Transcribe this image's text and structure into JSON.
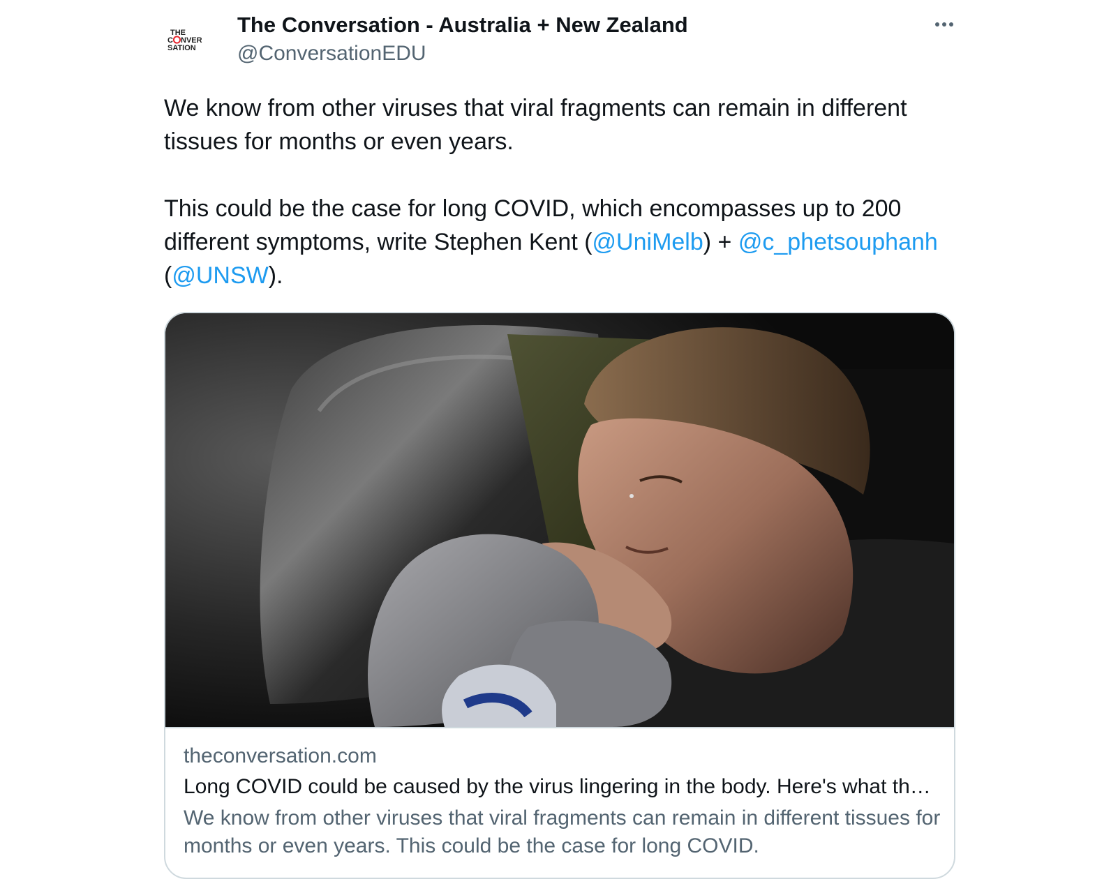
{
  "author": {
    "avatar_text": [
      "THE",
      "CONVER",
      "SATION"
    ],
    "name": "The Conversation - Australia + New Zealand",
    "handle": "@ConversationEDU"
  },
  "more_icon": "more-horizontal-icon",
  "tweet": {
    "paragraph1": "We know from other viruses that viral fragments can remain in different tissues for months or even years.",
    "paragraph2": {
      "text_before": "This could be the case for long COVID, which encompasses up to 200 different symptoms, write Stephen Kent (",
      "mention1": "@UniMelb",
      "text_middle": ") + ",
      "mention2": "@c_phetsouphanh",
      "text_between": " (",
      "mention3": "@UNSW",
      "text_after": ")."
    }
  },
  "card": {
    "image_alt": "woman-resting-on-couch-photo",
    "domain": "theconversation.com",
    "title": "Long COVID could be caused by the virus lingering in the body. Here's what the science says",
    "description": "We know from other viruses that viral fragments can remain in different tissues for months or even years. This could be the case for long COVID."
  },
  "colors": {
    "link": "#1d9bf0",
    "secondary_text": "#536471",
    "primary_text": "#0f1419",
    "border": "#cfd9de",
    "avatar_accent": "#e8262e"
  }
}
